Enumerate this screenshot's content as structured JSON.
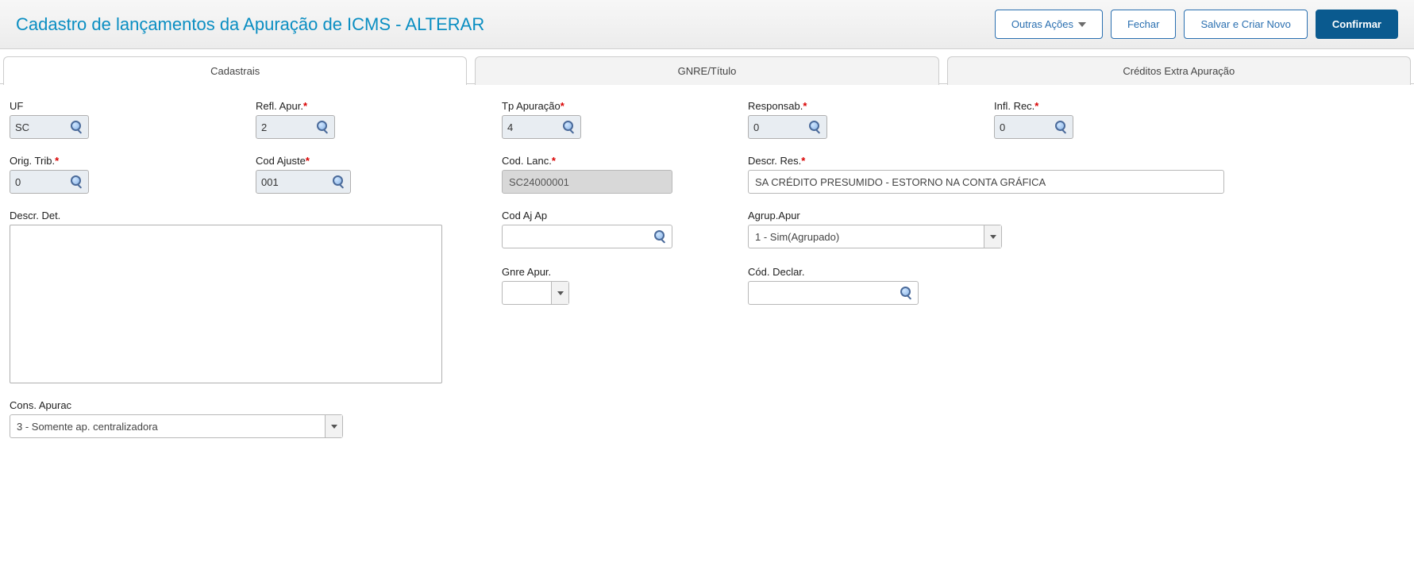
{
  "header": {
    "title": "Cadastro de lançamentos da Apuração de ICMS - ALTERAR",
    "buttons": {
      "other_actions": "Outras Ações",
      "close": "Fechar",
      "save_new": "Salvar e Criar Novo",
      "confirm": "Confirmar"
    }
  },
  "tabs": {
    "t1": "Cadastrais",
    "t2": "GNRE/Título",
    "t3": "Créditos Extra Apuração"
  },
  "labels": {
    "uf": "UF",
    "refl_apur": "Refl. Apur.",
    "tp_apur": "Tp Apuração",
    "responsab": "Responsab.",
    "infl_rec": "Infl. Rec.",
    "orig_trib": "Orig. Trib.",
    "cod_ajuste": "Cod Ajuste",
    "cod_lanc": "Cod. Lanc.",
    "descr_res": "Descr. Res.",
    "descr_det": "Descr. Det.",
    "cod_aj_ap": "Cod Aj Ap",
    "agrup_apur": "Agrup.Apur",
    "gnre_apur": "Gnre Apur.",
    "cod_declar": "Cód. Declar.",
    "cons_apurac": "Cons. Apurac"
  },
  "values": {
    "uf": "SC",
    "refl_apur": "2",
    "tp_apur": "4",
    "responsab": "0",
    "infl_rec": "0",
    "orig_trib": "0",
    "cod_ajuste": "001",
    "cod_lanc": "SC24000001",
    "descr_res": "SA CRÉDITO PRESUMIDO - ESTORNO NA CONTA GRÁFICA",
    "descr_det": "",
    "cod_aj_ap": "",
    "agrup_apur": "1 - Sim(Agrupado)",
    "gnre_apur": "",
    "cod_declar": "",
    "cons_apurac": "3 - Somente ap. centralizadora"
  }
}
